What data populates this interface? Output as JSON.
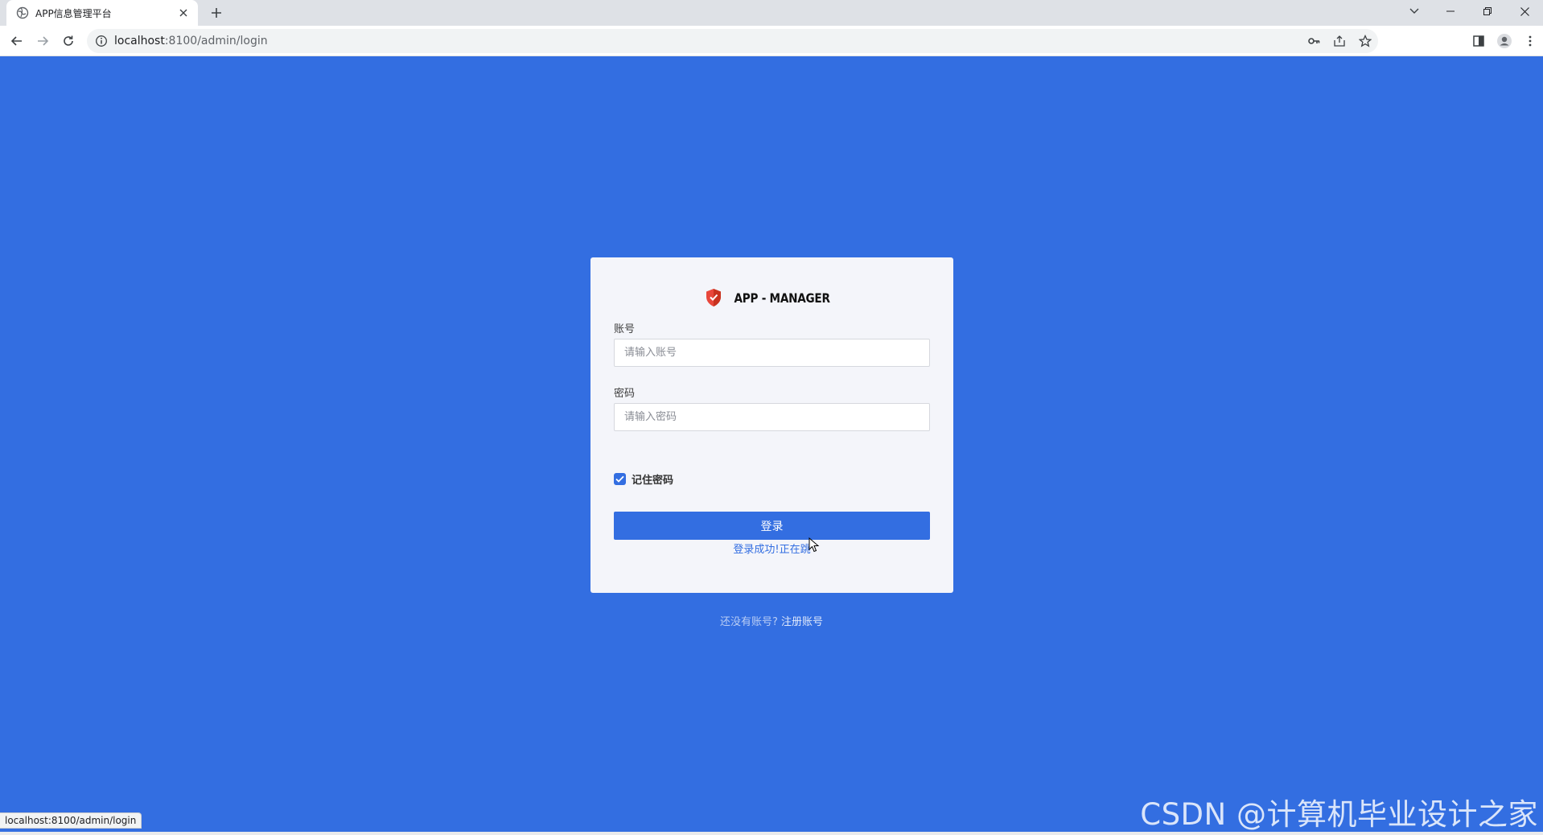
{
  "browser": {
    "tab_title": "APP信息管理平台",
    "new_tab_label": "+",
    "address": {
      "host": "localhost",
      "path": ":8100/admin/login"
    },
    "status_url": "localhost:8100/admin/login"
  },
  "login": {
    "logo_text": "APP - MANAGER",
    "account_label": "账号",
    "account_placeholder": "请输入账号",
    "password_label": "密码",
    "password_placeholder": "请输入密码",
    "remember_label": "记住密码",
    "remember_checked": true,
    "submit_label": "登录",
    "status_message": "登录成功!正在跳",
    "no_account_text": "还没有账号?",
    "register_link": "注册账号"
  },
  "watermark": "CSDN @计算机毕业设计之家",
  "colors": {
    "page_bg": "#336ee1",
    "card_bg": "#f4f5fa",
    "primary": "#336ee1",
    "logo_shield": "#e8473b"
  },
  "icons": {
    "favicon": "globe-icon",
    "logo": "shield-icon"
  }
}
